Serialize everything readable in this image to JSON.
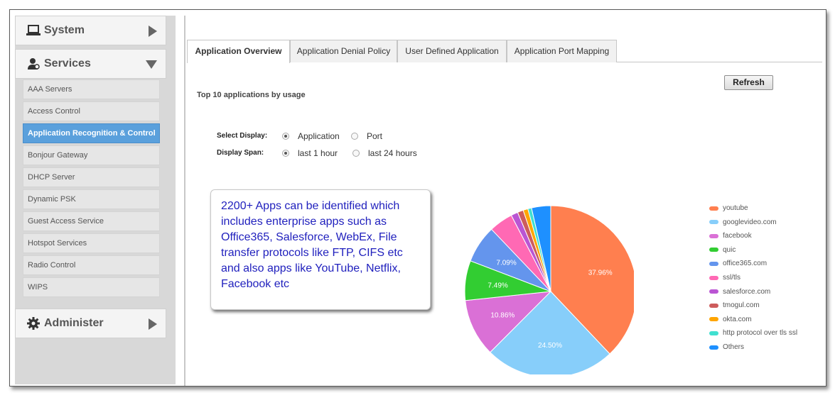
{
  "sidebar": {
    "system": {
      "label": "System",
      "icon": "laptop-icon"
    },
    "services": {
      "label": "Services",
      "icon": "services-icon",
      "items": [
        {
          "label": "AAA Servers",
          "active": false
        },
        {
          "label": "Access Control",
          "active": false
        },
        {
          "label": "Application Recognition & Control",
          "active": true
        },
        {
          "label": "Bonjour Gateway",
          "active": false
        },
        {
          "label": "DHCP Server",
          "active": false
        },
        {
          "label": "Dynamic PSK",
          "active": false
        },
        {
          "label": "Guest Access Service",
          "active": false
        },
        {
          "label": "Hotspot Services",
          "active": false
        },
        {
          "label": "Radio Control",
          "active": false
        },
        {
          "label": "WIPS",
          "active": false
        }
      ]
    },
    "administer": {
      "label": "Administer",
      "icon": "gear-icon"
    }
  },
  "tabs": [
    {
      "label": "Application Overview",
      "active": true
    },
    {
      "label": "Application Denial Policy",
      "active": false
    },
    {
      "label": "User Defined Application",
      "active": false
    },
    {
      "label": "Application Port Mapping",
      "active": false
    }
  ],
  "main": {
    "refresh_label": "Refresh",
    "section_title": "Top 10 applications by usage",
    "select_display": {
      "label": "Select Display:",
      "options": [
        "Application",
        "Port"
      ],
      "selected": "Application"
    },
    "display_span": {
      "label": "Display Span:",
      "options": [
        "last 1 hour",
        "last 24 hours"
      ],
      "selected": "last 1 hour"
    },
    "callout_text": "2200+ Apps can be identified which includes enterprise apps such as Office365, Salesforce, WebEx, File transfer protocols like FTP, CIFS etc and also apps like YouTube, Netflix, Facebook etc"
  },
  "chart_data": {
    "type": "pie",
    "title": "",
    "categories": [
      "youtube",
      "googlevideo.com",
      "facebook",
      "quic",
      "office365.com",
      "ssl/tls",
      "salesforce.com",
      "tmogul.com",
      "okta.com",
      "http protocol over tls ssl",
      "Others"
    ],
    "values": [
      37.96,
      24.5,
      10.86,
      7.49,
      7.09,
      4.5,
      1.3,
      1.1,
      0.9,
      0.7,
      3.6
    ],
    "data_labels": [
      "37.96%",
      "24.50%",
      "10.86%",
      "7.49%",
      "7.09%",
      "",
      "",
      "",
      "",
      "",
      ""
    ],
    "colors": [
      "#ff7f4f",
      "#87cefa",
      "#da70d6",
      "#32cd32",
      "#6495ed",
      "#ff69b4",
      "#ba55d3",
      "#cd5c5c",
      "#ffa500",
      "#40e0d0",
      "#1e90ff"
    ],
    "legend_position": "right"
  }
}
